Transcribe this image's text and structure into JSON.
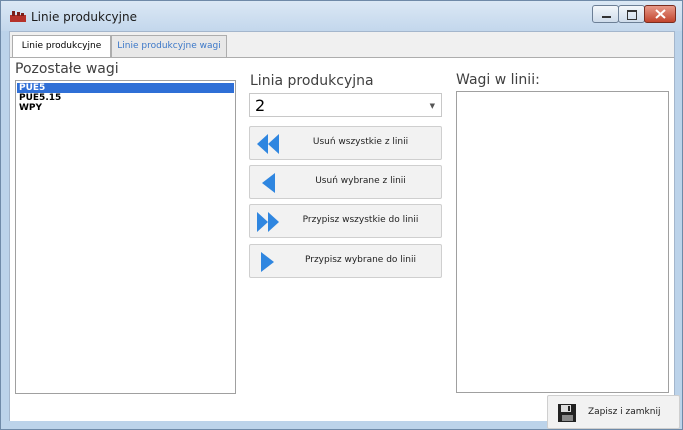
{
  "window": {
    "title": "Linie produkcyjne"
  },
  "tabs": [
    {
      "label": "Linie produkcyjne"
    },
    {
      "label": "Linie produkcyjne wagi"
    }
  ],
  "left": {
    "title": "Pozostałe wagi",
    "items": [
      "PUE5",
      "PUE5.15",
      "WPY"
    ]
  },
  "middle": {
    "title": "Linia produkcyjna",
    "combo_value": "2",
    "buttons": {
      "remove_all": "Usuń wszystkie z linii",
      "remove_selected": "Usuń wybrane z linii",
      "assign_all": "Przypisz wszystkie do linii",
      "assign_selected": "Przypisz wybrane do linii"
    }
  },
  "right": {
    "title": "Wagi w linii:"
  },
  "footer": {
    "save_label": "Zapisz i zamknij"
  }
}
